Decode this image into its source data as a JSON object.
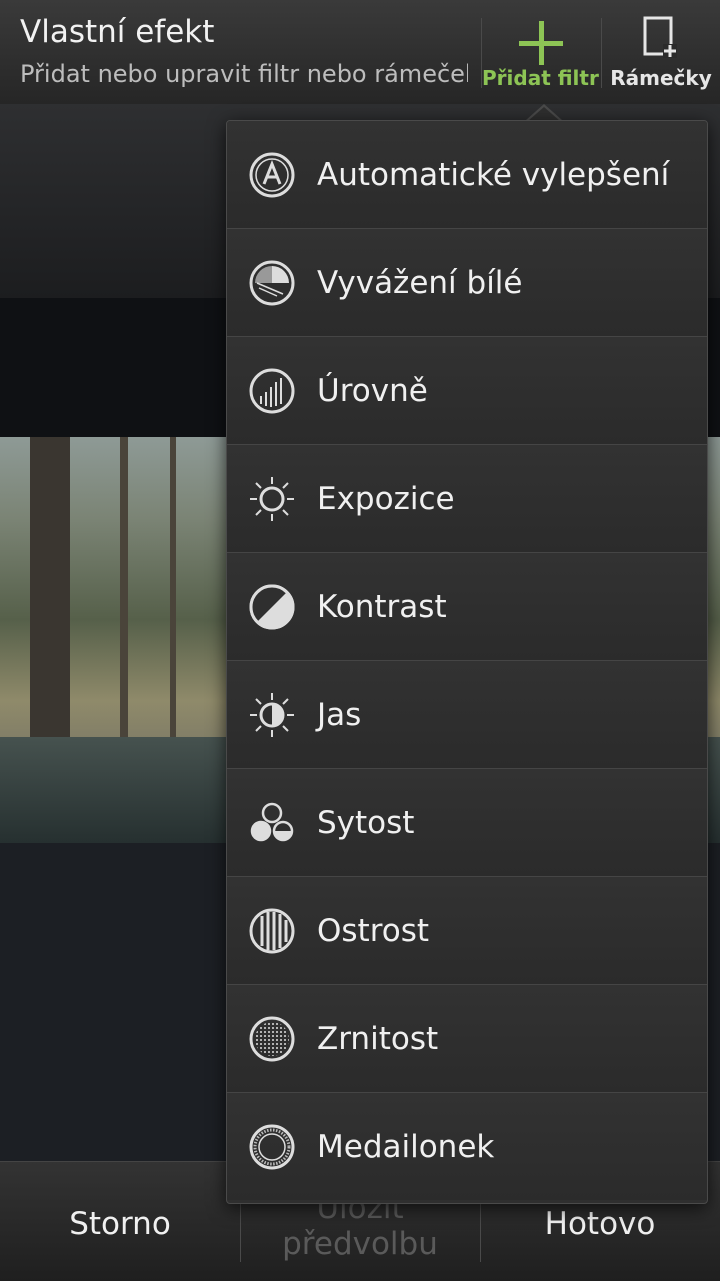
{
  "header": {
    "title": "Vlastní efekt",
    "subtitle": "Přidat nebo upravit filtr nebo rámeček",
    "add_filter_label": "Přidat filtr",
    "frames_label": "Rámečky",
    "accent_color": "#8dc455"
  },
  "menu": {
    "items": [
      {
        "label": "Automatické vylepšení",
        "icon": "auto-enhance-icon"
      },
      {
        "label": "Vyvážení bílé",
        "icon": "white-balance-icon"
      },
      {
        "label": "Úrovně",
        "icon": "levels-icon"
      },
      {
        "label": "Expozice",
        "icon": "exposure-icon"
      },
      {
        "label": "Kontrast",
        "icon": "contrast-icon"
      },
      {
        "label": "Jas",
        "icon": "brightness-icon"
      },
      {
        "label": "Sytost",
        "icon": "saturation-icon"
      },
      {
        "label": "Ostrost",
        "icon": "sharpness-icon"
      },
      {
        "label": "Zrnitost",
        "icon": "grain-icon"
      },
      {
        "label": "Medailonek",
        "icon": "vignette-icon"
      }
    ]
  },
  "footer": {
    "cancel_label": "Storno",
    "save_preset_line1": "Uložit",
    "save_preset_line2": "předvolbu",
    "done_label": "Hotovo"
  }
}
